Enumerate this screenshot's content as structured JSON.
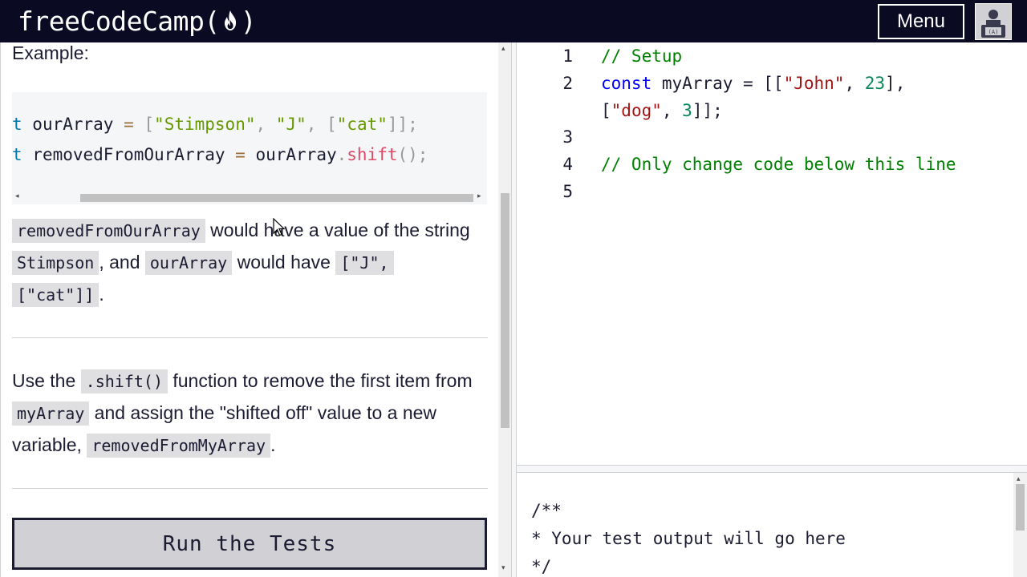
{
  "nav": {
    "logo_prefix": "freeCodeCamp(",
    "logo_suffix": ")",
    "menu_label": "Menu",
    "logo_icon": "flame-icon",
    "avatar_icon": "user-avatar-icon",
    "colors": {
      "bar": "#0a0a23",
      "text": "#ffffff"
    }
  },
  "instructions": {
    "example_label": "Example:",
    "code_lines": [
      [
        "t ",
        "ourArray ",
        "= ",
        "[",
        "\"Stimpson\"",
        ", ",
        "\"J\"",
        ", ",
        "[",
        "\"cat\"",
        "]];"
      ],
      [
        "t ",
        "removedFromOurArray ",
        "= ",
        "ourArray",
        ".",
        "shift",
        "();"
      ]
    ],
    "para1": {
      "code1": "removedFromOurArray",
      "text1": " would have a value of the string ",
      "code2": "Stimpson",
      "text2": ", and ",
      "code3": "ourArray",
      "text3": " would have ",
      "code4": "[\"J\",",
      "code5": "[\"cat\"]]",
      "text4": "."
    },
    "para2": {
      "text1": "Use the ",
      "code1": ".shift()",
      "text2": " function to remove the first item from ",
      "code2": "myArray",
      "text3": " and assign the \"shifted off\" value to a new variable, ",
      "code3": "removedFromMyArray",
      "text4": "."
    },
    "run_button": "Run the Tests"
  },
  "editor": {
    "line_numbers": [
      "1",
      "2",
      "3",
      "4",
      "5"
    ],
    "lines": {
      "l1": "// Setup",
      "l2_kw": "const",
      "l2_a": " myArray = [[",
      "l2_s1": "\"John\"",
      "l2_b": ", ",
      "l2_n1": "23",
      "l2_c": "],",
      "l2w_a": "[",
      "l2w_s2": "\"dog\"",
      "l2w_b": ", ",
      "l2w_n2": "3",
      "l2w_c": "]];",
      "l4": "// Only change code below this line"
    },
    "colors": {
      "comment": "#008000",
      "keyword": "#0000ff",
      "string": "#a31515",
      "number": "#098658"
    }
  },
  "output": {
    "lines": [
      "/**",
      "* Your test output will go here",
      "*/"
    ]
  }
}
